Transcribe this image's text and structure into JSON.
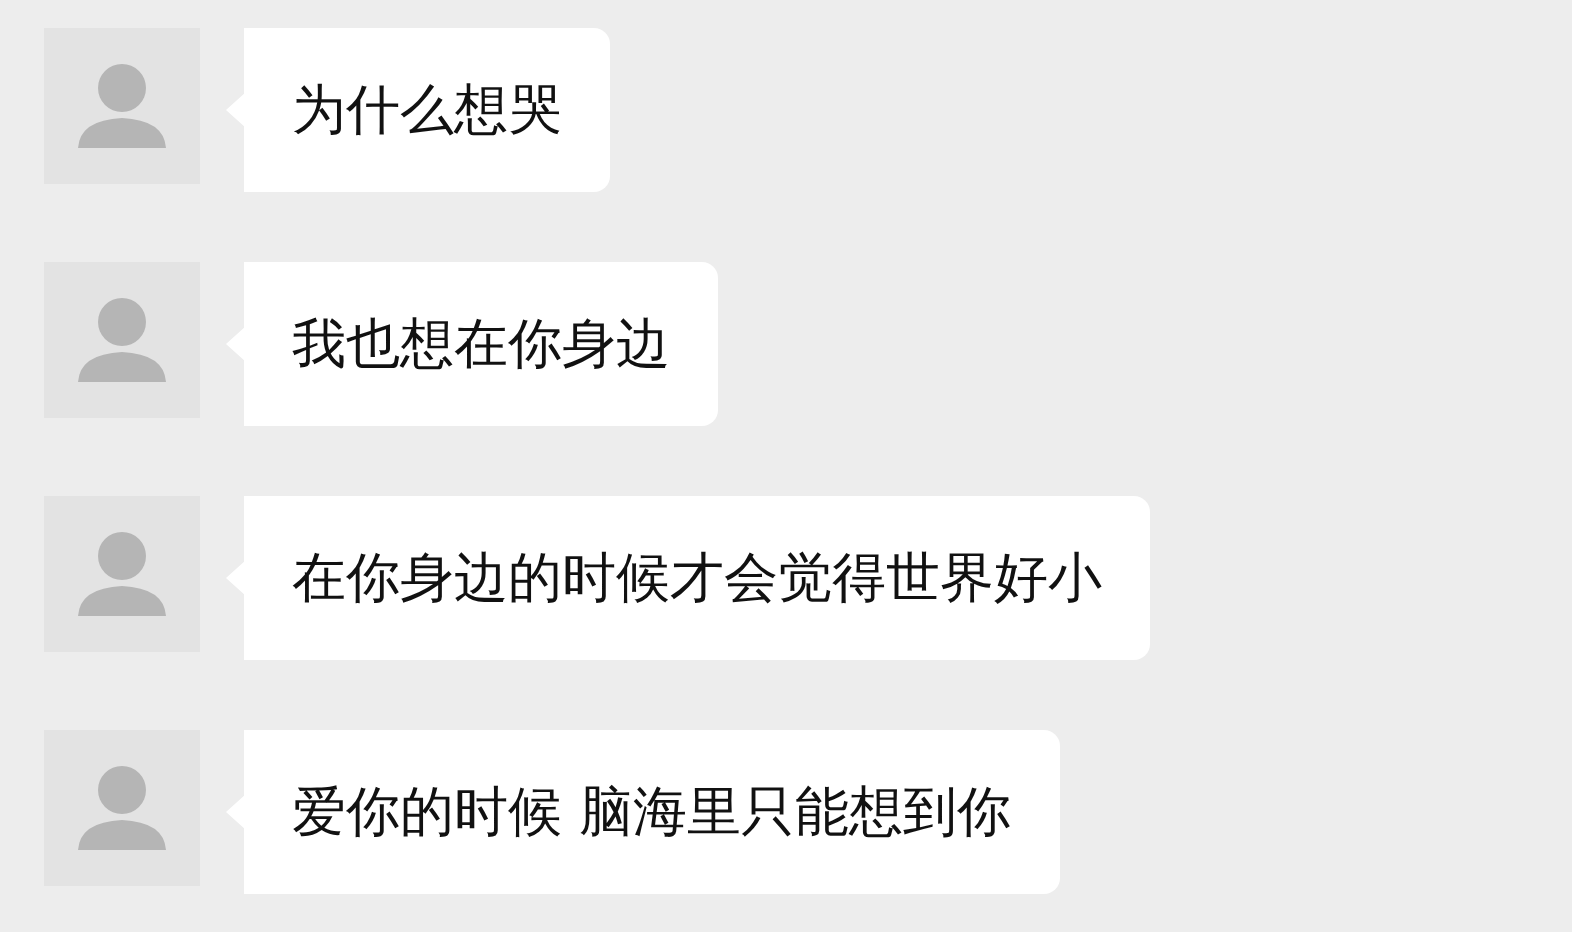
{
  "messages": [
    {
      "text": "为什么想哭"
    },
    {
      "text": "我也想在你身边"
    },
    {
      "text": "在你身边的时候才会觉得世界好小"
    },
    {
      "text": "爱你的时候 脑海里只能想到你"
    }
  ]
}
